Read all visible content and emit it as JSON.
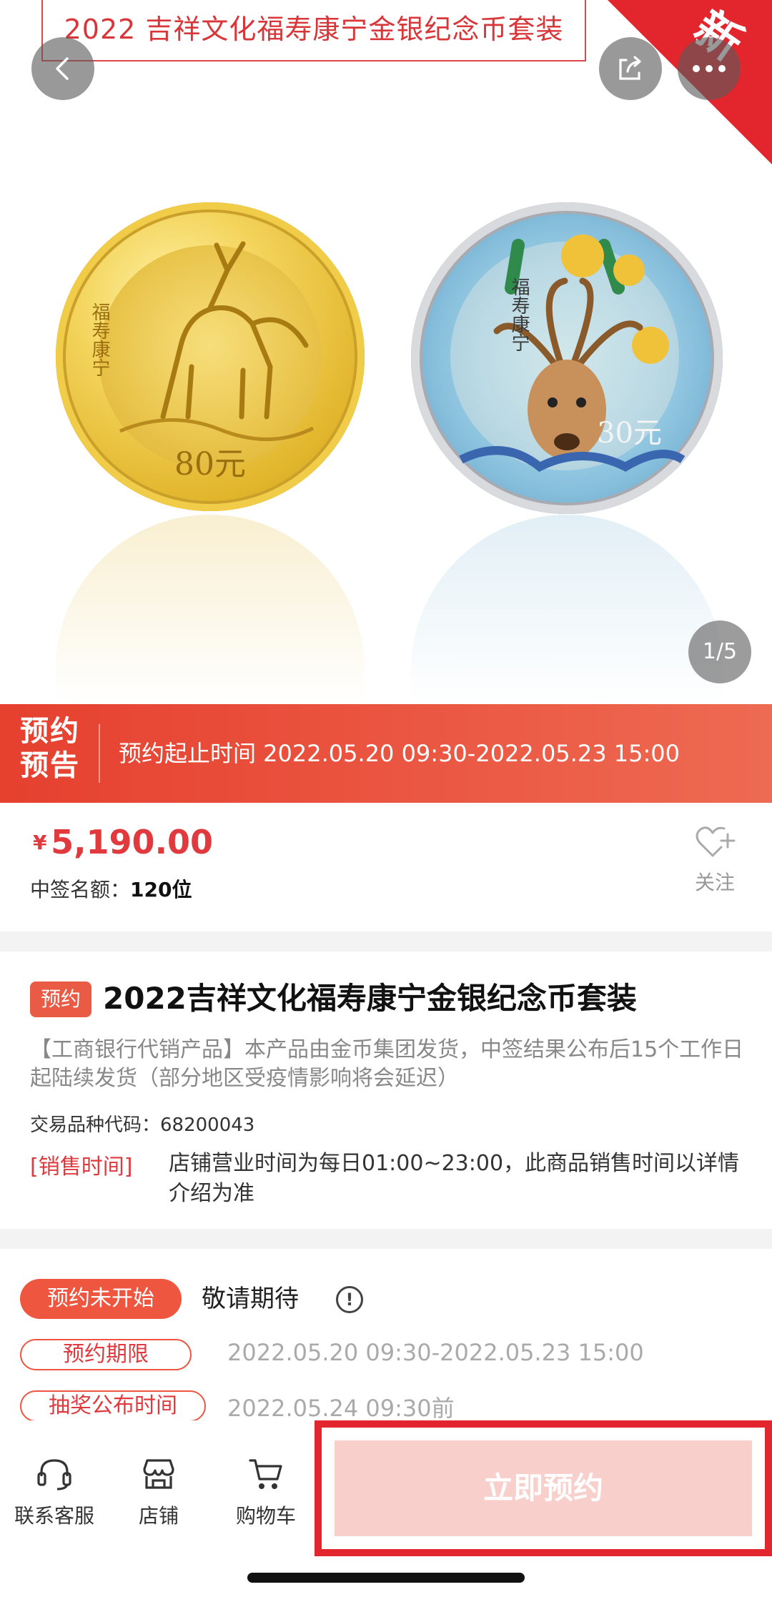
{
  "hero": {
    "banner_title": "2022 吉祥文化福寿康宁金银纪念币套装",
    "corner_badge": "新",
    "pager": "1/5",
    "gold_coin": {
      "label": "福寿康宁",
      "denomination": "80元"
    },
    "silver_coin": {
      "label": "福寿康宁",
      "denomination": "30元"
    }
  },
  "preorder": {
    "badge": "预约预告",
    "range": "预约起止时间 2022.05.20 09:30-2022.05.23 15:00"
  },
  "price": {
    "currency": "¥",
    "amount": "5,190.00",
    "quota_label": "中签名额：",
    "quota_value": "120位",
    "favorite_label": "关注"
  },
  "product": {
    "tag": "预约",
    "title": "2022吉祥文化福寿康宁金银纪念币套装",
    "description": "【工商银行代销产品】本产品由金币集团发货，中签结果公布后15个工作日起陆续发货（部分地区受疫情影响将会延迟）",
    "code_label": "交易品种代码：",
    "code_value": "68200043",
    "sale_time_label": "[销售时间]",
    "sale_time_text": "店铺营业时间为每日01:00~23:00，此商品销售时间以详情介绍为准"
  },
  "status": {
    "badge": "预约未开始",
    "text": "敬请期待",
    "period_label": "预约期限",
    "period_value": "2022.05.20 09:30-2022.05.23 15:00",
    "draw_label": "抽奖公布时间",
    "draw_value": "2022.05.24 09:30前"
  },
  "bottom_nav": {
    "customer_service": "联系客服",
    "shop": "店铺",
    "cart": "购物车",
    "reserve_button": "立即预约"
  },
  "colors": {
    "accent": "#e0393e",
    "strip_start": "#e6402f",
    "strip_end": "#ee6a52",
    "reserve_disabled": "#f8cfcb"
  }
}
